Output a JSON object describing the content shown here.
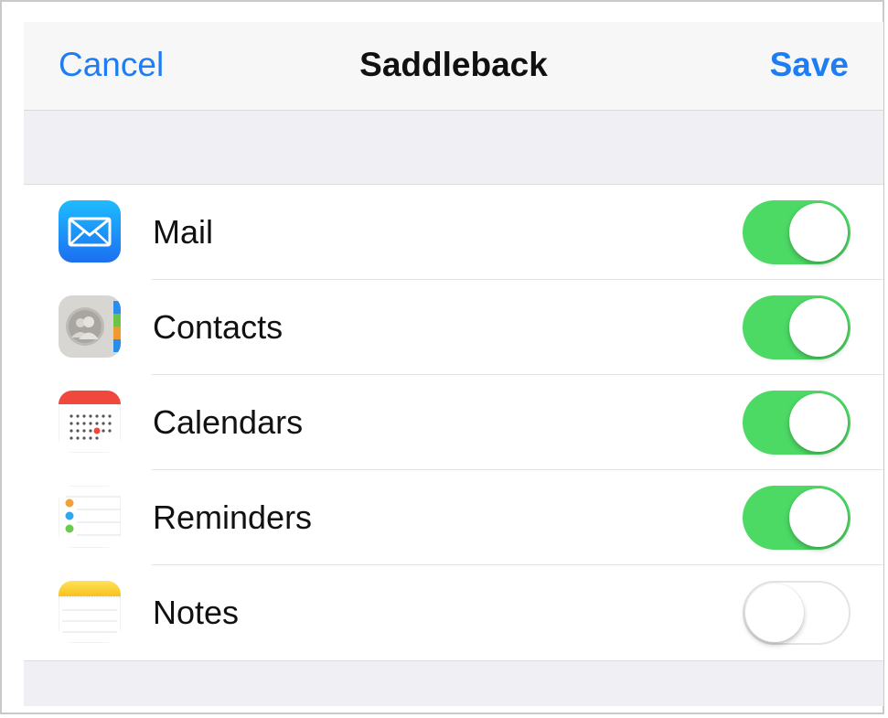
{
  "navbar": {
    "cancel_label": "Cancel",
    "title": "Saddleback",
    "save_label": "Save"
  },
  "colors": {
    "accent": "#1f7df2",
    "toggle_on": "#4cd964",
    "background": "#efeff4"
  },
  "services": [
    {
      "label": "Mail",
      "icon": "mail-icon",
      "enabled": true
    },
    {
      "label": "Contacts",
      "icon": "contacts-icon",
      "enabled": true
    },
    {
      "label": "Calendars",
      "icon": "calendar-icon",
      "enabled": true
    },
    {
      "label": "Reminders",
      "icon": "reminders-icon",
      "enabled": true
    },
    {
      "label": "Notes",
      "icon": "notes-icon",
      "enabled": false
    }
  ]
}
